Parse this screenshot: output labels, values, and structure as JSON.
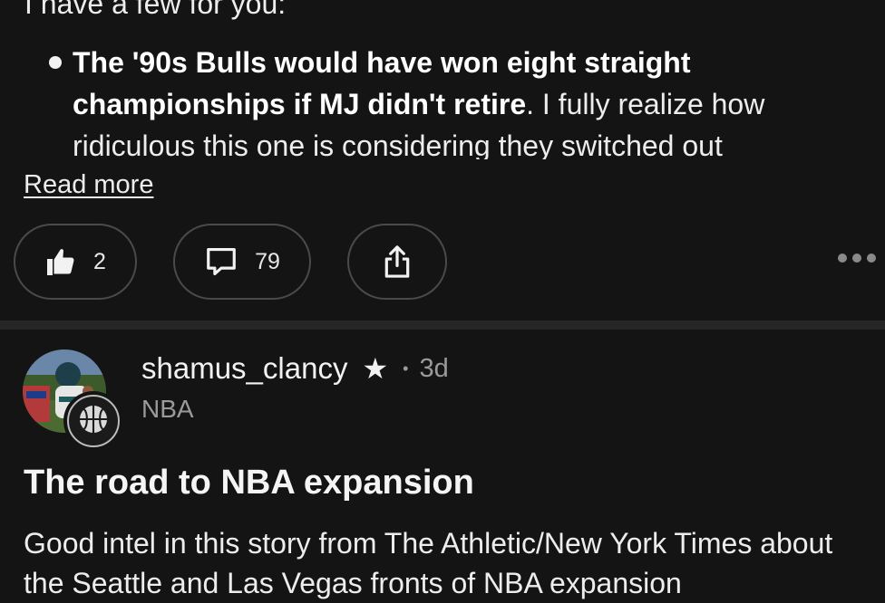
{
  "previous_post": {
    "intro_text": "I have a few for you:",
    "bullet_bold": "The '90s Bulls would have won eight straight championships if MJ didn't retire",
    "bullet_rest": ". I fully realize how ridiculous this one is considering they switched out",
    "read_more_label": "Read more"
  },
  "actions": {
    "like_count": "2",
    "comment_count": "79",
    "icons": [
      "thumbs-up-icon",
      "comment-icon",
      "share-icon",
      "more-icon"
    ]
  },
  "post": {
    "username": "shamus_clancy",
    "star_glyph": "★",
    "separator": "•",
    "time": "3d",
    "community": "NBA",
    "title": "The road to NBA expansion",
    "body": "Good intel in this story from The Athletic/New York Times about the Seattle and Las Vegas fronts of NBA expansion"
  },
  "colors": {
    "background": "#141414",
    "text": "#f2f2f2",
    "muted": "#9a9a9a",
    "pill_border": "#4a4a4a",
    "divider": "#262626"
  }
}
